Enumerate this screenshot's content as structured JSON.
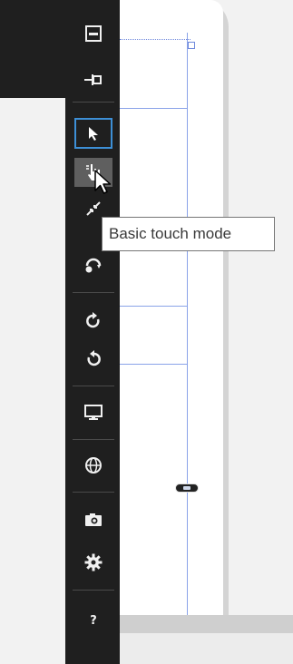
{
  "tooltip": {
    "text": "Basic touch mode"
  },
  "toolbar": {
    "tools": [
      {
        "id": "minimize",
        "icon": "minimize-icon"
      },
      {
        "id": "pin",
        "icon": "pin-icon"
      },
      {
        "id": "select",
        "icon": "pointer-icon",
        "state": "selected"
      },
      {
        "id": "basic-touch",
        "icon": "touch-hand-icon",
        "state": "hover"
      },
      {
        "id": "pinch-zoom",
        "icon": "pinch-icon"
      },
      {
        "id": "rotation-touch",
        "icon": "rotate-touch-icon"
      },
      {
        "id": "rotate-clockwise",
        "icon": "rotate-clockwise-icon"
      },
      {
        "id": "rotate-counterclockwise",
        "icon": "rotate-counterclockwise-icon"
      },
      {
        "id": "fit-to-screen",
        "icon": "monitor-icon"
      },
      {
        "id": "network",
        "icon": "globe-icon"
      },
      {
        "id": "screenshot",
        "icon": "camera-icon"
      },
      {
        "id": "tools",
        "icon": "gear-icon"
      },
      {
        "id": "help",
        "icon": "help-icon",
        "glyph": "?"
      }
    ]
  },
  "colors": {
    "toolbar_bg": "#1f1f1f",
    "selected_outline": "#3d8fd6",
    "hover_bg": "#5f5f5f",
    "guide_line": "#8aa3e8",
    "device_frame": "#d4d4d4"
  }
}
